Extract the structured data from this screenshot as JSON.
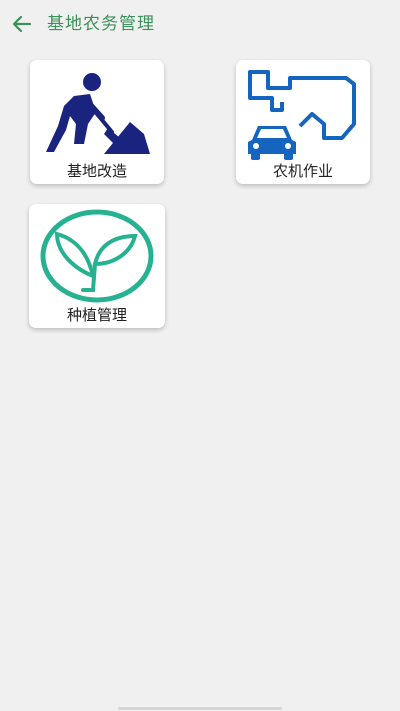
{
  "header": {
    "title": "基地农务管理",
    "back_icon": "arrow-left-icon",
    "accent_color": "#3d8f5a"
  },
  "cards": [
    {
      "label": "基地改造",
      "icon": "worker-shovel-icon",
      "color": "#1a237e"
    },
    {
      "label": "农机作业",
      "icon": "tractor-route-icon",
      "color": "#1565c0"
    },
    {
      "label": "种植管理",
      "icon": "sprout-icon",
      "color": "#26b291"
    }
  ]
}
